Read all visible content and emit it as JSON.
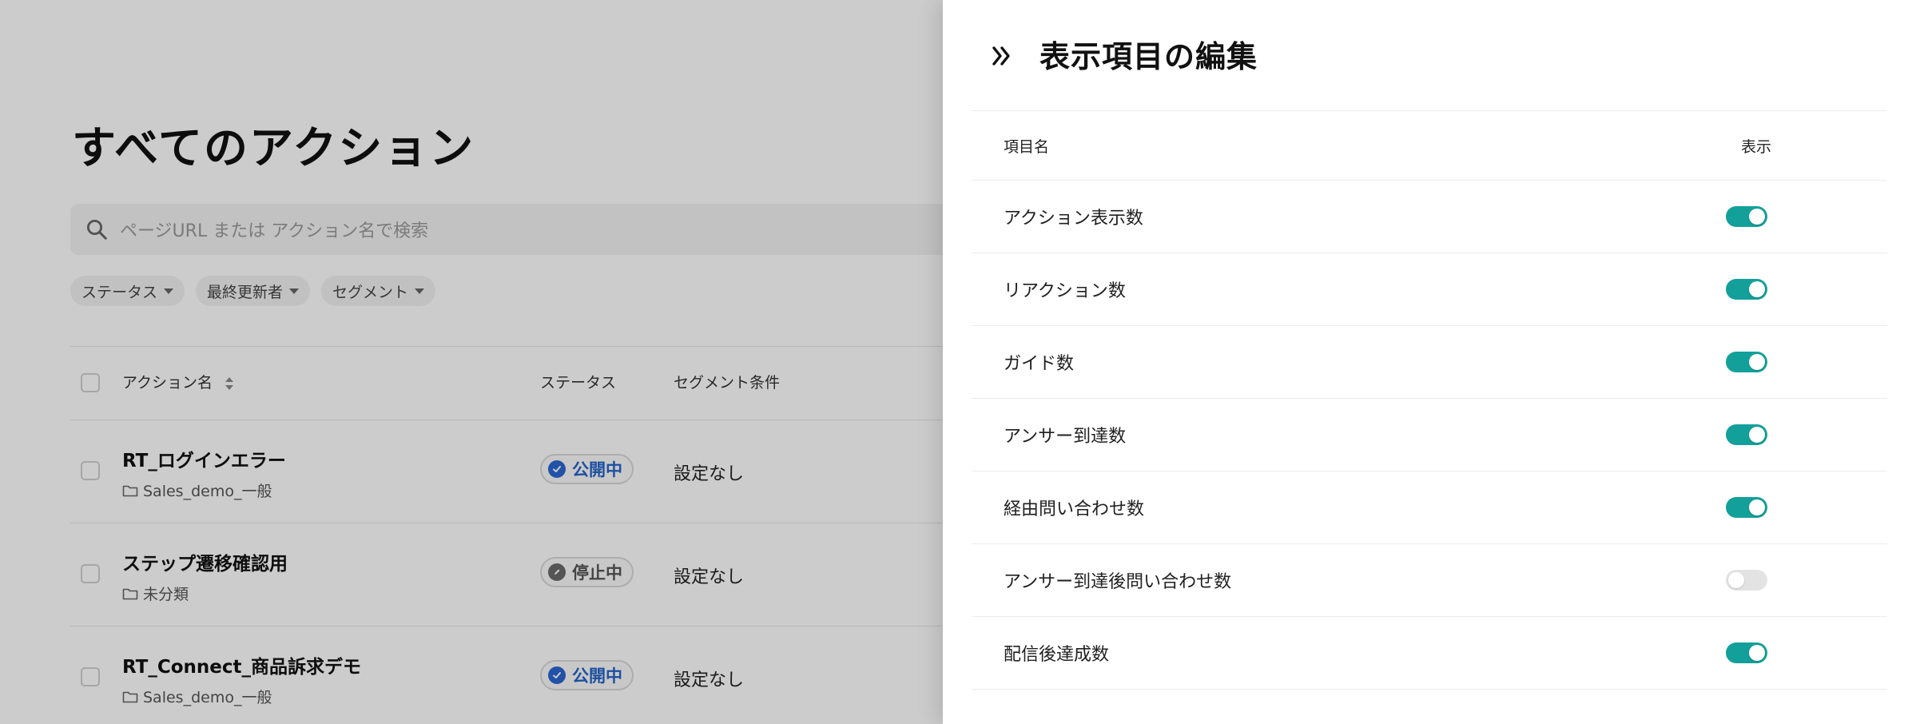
{
  "page": {
    "title": "すべてのアクション",
    "search_placeholder": "ページURL または アクション名で検索",
    "filters": [
      "ステータス",
      "最終更新者",
      "セグメント"
    ],
    "columns": {
      "name": "アクション名",
      "status": "ステータス",
      "segment": "セグメント条件"
    },
    "rows": [
      {
        "name": "RT_ログインエラー",
        "folder": "Sales_demo_一般",
        "status": "公開中",
        "status_type": "published",
        "segment": "設定なし"
      },
      {
        "name": "ステップ遷移確認用",
        "folder": "未分類",
        "status": "停止中",
        "status_type": "stopped",
        "segment": "設定なし"
      },
      {
        "name": "RT_Connect_商品訴求デモ",
        "folder": "Sales_demo_一般",
        "status": "公開中",
        "status_type": "published",
        "segment": "設定なし"
      }
    ]
  },
  "panel": {
    "title": "表示項目の編集",
    "header_name": "項目名",
    "header_display": "表示",
    "items": [
      {
        "label": "アクション表示数",
        "enabled": true
      },
      {
        "label": "リアクション数",
        "enabled": true
      },
      {
        "label": "ガイド数",
        "enabled": true
      },
      {
        "label": "アンサー到達数",
        "enabled": true
      },
      {
        "label": "経由問い合わせ数",
        "enabled": true
      },
      {
        "label": "アンサー到達後問い合わせ数",
        "enabled": false
      },
      {
        "label": "配信後達成数",
        "enabled": true
      }
    ]
  },
  "colors": {
    "toggle_on": "#14a09a",
    "toggle_off": "#e3e3e3",
    "published": "#2563c9",
    "stopped": "#555555"
  },
  "icons": {
    "search": "search-icon",
    "collapse": "double-chevron-right-icon",
    "folder": "folder-icon",
    "sort": "sort-icon",
    "published": "check-circle-icon",
    "stopped": "pencil-circle-icon"
  }
}
